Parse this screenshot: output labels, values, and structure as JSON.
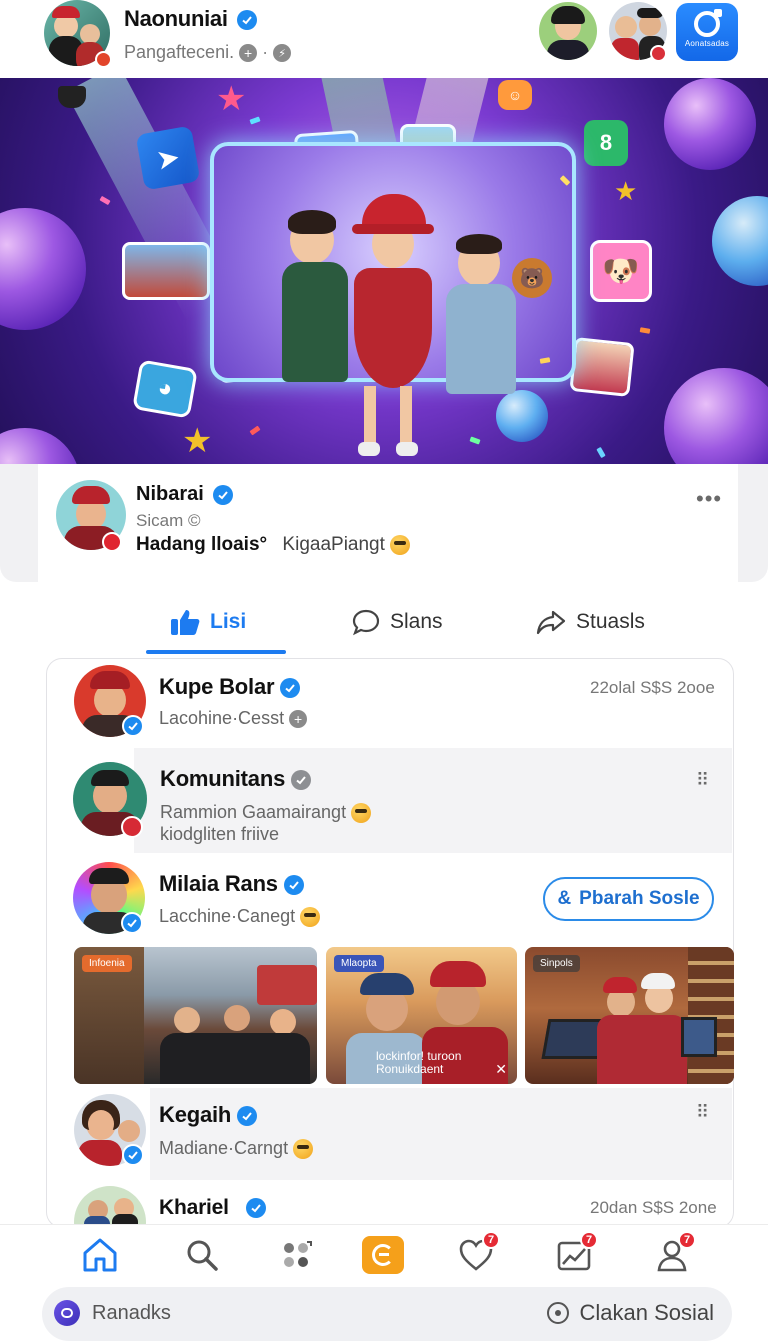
{
  "header": {
    "title": "Naonuniai",
    "subtitle": "Pangafteceni.",
    "action_label": "Aonatsadas",
    "accent": "#1d8bf0"
  },
  "profile": {
    "name": "Nibarai",
    "sub": "Sicam ©",
    "line_bold": "Hadang lloais°",
    "line_extra": "KigaaPiangt"
  },
  "tabs": [
    {
      "label": "Lisi",
      "icon": "thumbs-up-icon"
    },
    {
      "label": "Slans",
      "icon": "comment-icon"
    },
    {
      "label": "Stuasls",
      "icon": "share-icon"
    }
  ],
  "feed": {
    "posts": [
      {
        "name": "Kupe Bolar",
        "sub": "Lacohine·Cesst",
        "time": "22olal S$S 2ooe"
      },
      {
        "name": "Komunitans",
        "sub": "Rammion Gaamairangt",
        "sub2": "kiodgliten friive"
      },
      {
        "name": "Milaia Rans",
        "sub": "Lacchine·Canegt",
        "follow": "Pbarah Sosle"
      },
      {
        "name": "Kegaih",
        "sub": "Madiane·Carngt"
      },
      {
        "name": "Khariel",
        "time": "20dan S$S 2one"
      }
    ],
    "photos": [
      {
        "tag": "Infoenia"
      },
      {
        "tag": "Mlaopta",
        "caption_line1": "lockinfor! turoon",
        "caption_line2": "Ronuikdaent"
      },
      {
        "tag": "Sinpols"
      }
    ]
  },
  "bottom_nav": {
    "items": [
      {
        "icon": "home-icon"
      },
      {
        "icon": "search-icon"
      },
      {
        "icon": "apps-icon"
      },
      {
        "icon": "create-icon"
      },
      {
        "icon": "heart-icon",
        "badge": "7"
      },
      {
        "icon": "activity-icon",
        "badge": "7"
      },
      {
        "icon": "profile-icon",
        "badge": "7"
      }
    ]
  },
  "bottom_bar": {
    "left_label": "Ranadks",
    "right_label": "Clakan Sosial"
  }
}
